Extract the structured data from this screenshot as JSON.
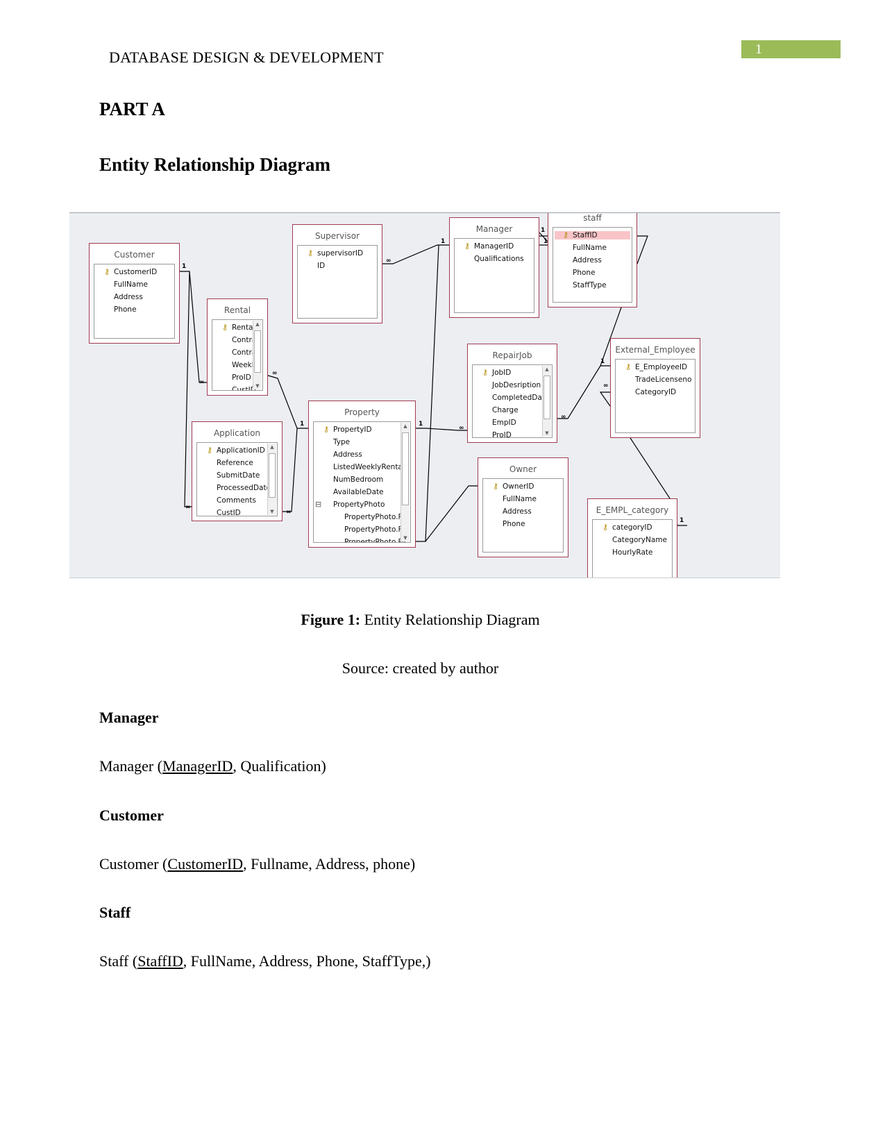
{
  "header": {
    "running_head": "DATABASE DESIGN & DEVELOPMENT",
    "page_number": "1",
    "page_number_bg": "#9bbb59"
  },
  "headings": {
    "part": "PART A",
    "erd": "Entity Relationship Diagram"
  },
  "diagram": {
    "entities": [
      {
        "id": "customer",
        "title": "Customer",
        "fields": [
          "CustomerID",
          "FullName",
          "Address",
          "Phone"
        ],
        "key": "CustomerID"
      },
      {
        "id": "supervisor",
        "title": "Supervisor",
        "fields": [
          "supervisorID",
          "ID"
        ],
        "key": "supervisorID"
      },
      {
        "id": "manager",
        "title": "Manager",
        "fields": [
          "ManagerID",
          "Qualifications"
        ],
        "key": "ManagerID"
      },
      {
        "id": "staff",
        "title": "staff",
        "fields": [
          "StaffID",
          "FullName",
          "Address",
          "Phone",
          "StaffType"
        ],
        "key": "StaffID",
        "selected": "StaffID"
      },
      {
        "id": "rental",
        "title": "Rental",
        "fields": [
          "Rental",
          "Contra",
          "Contra",
          "Weekl",
          "ProID",
          "CustID"
        ],
        "key": "Rental",
        "scroll": true
      },
      {
        "id": "repairjob",
        "title": "RepairJob",
        "fields": [
          "JobID",
          "JobDesription",
          "CompletedDate",
          "Charge",
          "EmpID",
          "ProID"
        ],
        "key": "JobID",
        "scroll": true
      },
      {
        "id": "external_employee",
        "title": "External_Employee",
        "fields": [
          "E_EmployeeID",
          "TradeLicenseno",
          "CategoryID"
        ],
        "key": "E_EmployeeID"
      },
      {
        "id": "application",
        "title": "Application",
        "fields": [
          "ApplicationID",
          "Reference",
          "SubmitDate",
          "ProcessedDate",
          "Comments",
          "CustID"
        ],
        "key": "ApplicationID",
        "scroll": true
      },
      {
        "id": "property",
        "title": "Property",
        "fields": [
          "PropertyID",
          "Type",
          "Address",
          "ListedWeeklyRental",
          "NumBedroom",
          "AvailableDate",
          "PropertyPhoto",
          "PropertyPhoto.Fil",
          "PropertyPhoto.Fil",
          "PropertyPhoto.Fil"
        ],
        "key": "PropertyID",
        "scroll": true,
        "expand": "PropertyPhoto"
      },
      {
        "id": "owner",
        "title": "Owner",
        "fields": [
          "OwnerID",
          "FullName",
          "Address",
          "Phone"
        ],
        "key": "OwnerID"
      },
      {
        "id": "e_empl_category",
        "title": "E_EMPL_category",
        "fields": [
          "categoryID",
          "CategoryName",
          "HourlyRate"
        ],
        "key": "categoryID"
      }
    ],
    "cardinality": {
      "one": "1",
      "many": "∞"
    },
    "line_color": "#000000",
    "entity_border_color": "#a03a50",
    "selected_row_color": "#f8c4c8"
  },
  "figure": {
    "label": "Figure 1:",
    "title": " Entity Relationship Diagram",
    "source": "Source: created by author"
  },
  "sections": [
    {
      "heading": "Manager",
      "prefix": "Manager (",
      "key": "ManagerID",
      "suffix": ", Qualification)"
    },
    {
      "heading": "Customer",
      "prefix": "Customer (",
      "key": "CustomerID",
      "suffix": ", Fullname, Address, phone)"
    },
    {
      "heading": "Staff",
      "prefix": "Staff (",
      "key": "StaffID",
      "suffix": ", FullName, Address, Phone, StaffType,)"
    }
  ]
}
